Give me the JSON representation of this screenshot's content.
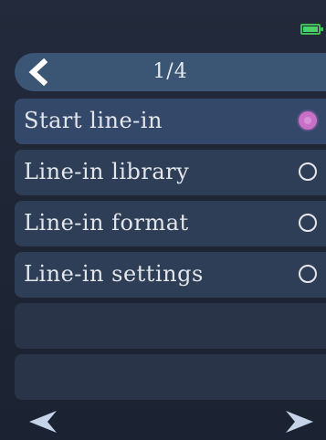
{
  "header": {
    "page_indicator": "1/4",
    "back_icon": "chevron-left-icon"
  },
  "status": {
    "battery_icon": "battery-full-icon",
    "battery_color": "#48d366"
  },
  "menu": {
    "items": [
      {
        "label": "Start line-in",
        "selected": true
      },
      {
        "label": "Line-in library",
        "selected": false
      },
      {
        "label": "Line-in format",
        "selected": false
      },
      {
        "label": "Line-in settings",
        "selected": false
      }
    ],
    "empty_rows": 2
  },
  "footer": {
    "prev_icon": "arrow-left-icon",
    "next_icon": "arrow-right-icon"
  },
  "colors": {
    "header_bg": "#3b5575",
    "item_bg": "#2f3e57",
    "selected_radio": "#c770c6",
    "text": "#e3e6ea"
  }
}
